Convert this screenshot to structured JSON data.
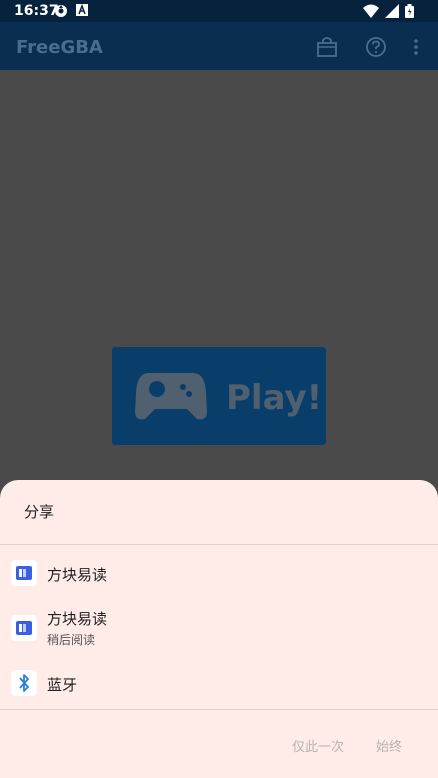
{
  "status": {
    "time": "16:37"
  },
  "app": {
    "title": "FreeGBA",
    "actions": [
      {
        "icon": "shopping-bag-icon"
      },
      {
        "icon": "help-icon"
      },
      {
        "icon": "more-vert-icon"
      }
    ]
  },
  "play": {
    "label": "Play!"
  },
  "share_sheet": {
    "title": "分享",
    "items": [
      {
        "label": "方块易读",
        "icon": "fangkuai-app-icon"
      },
      {
        "label": "方块易读",
        "sublabel": "稍后阅读",
        "icon": "fangkuai-app-icon"
      },
      {
        "label": "蓝牙",
        "icon": "bluetooth-icon"
      }
    ],
    "just_once": "仅此一次",
    "always": "始终"
  },
  "colors": {
    "accent": "#0a3e6a",
    "sheet_bg": "#ffece9",
    "bluetooth": "#2a7fd4"
  }
}
